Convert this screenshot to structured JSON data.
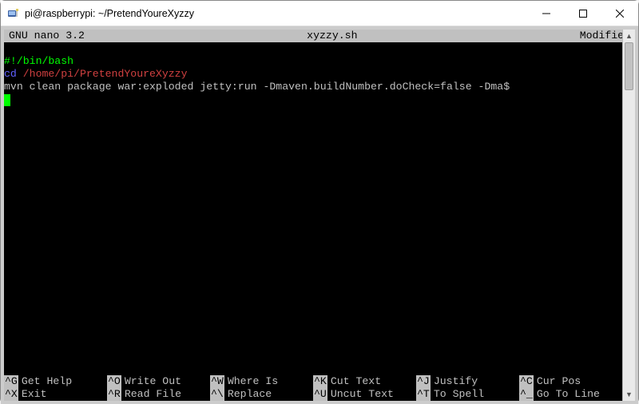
{
  "window": {
    "title": "pi@raspberrypi: ~/PretendYoureXyzzy"
  },
  "nano": {
    "version": "GNU nano 3.2",
    "filename": "xyzzy.sh",
    "status": "Modified"
  },
  "file_lines": {
    "l0": "#!/bin/bash",
    "l1_cmd": "cd",
    "l1_arg": " /home/pi/PretendYoureXyzzy",
    "l2": "mvn clean package war:exploded jetty:run -Dmaven.buildNumber.doCheck=false -Dma$"
  },
  "help": {
    "row1": [
      {
        "key": "^G",
        "label": "Get Help"
      },
      {
        "key": "^O",
        "label": "Write Out"
      },
      {
        "key": "^W",
        "label": "Where Is"
      },
      {
        "key": "^K",
        "label": "Cut Text"
      },
      {
        "key": "^J",
        "label": "Justify"
      },
      {
        "key": "^C",
        "label": "Cur Pos"
      }
    ],
    "row2": [
      {
        "key": "^X",
        "label": "Exit"
      },
      {
        "key": "^R",
        "label": "Read File"
      },
      {
        "key": "^\\",
        "label": "Replace"
      },
      {
        "key": "^U",
        "label": "Uncut Text"
      },
      {
        "key": "^T",
        "label": "To Spell"
      },
      {
        "key": "^_",
        "label": "Go To Line"
      }
    ]
  }
}
